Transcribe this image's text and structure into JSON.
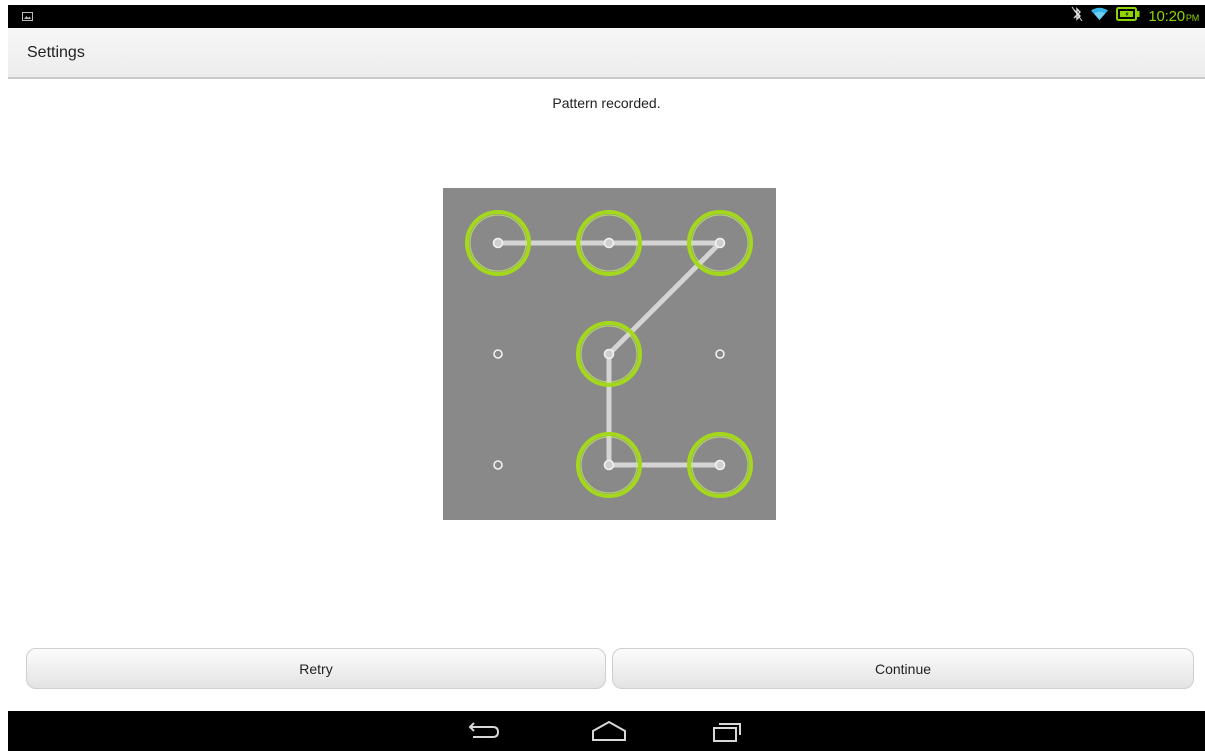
{
  "status_bar": {
    "time": "10:20",
    "ampm": "PM",
    "icons": [
      "picture-icon",
      "bluetooth-icon",
      "wifi-icon",
      "battery-icon"
    ]
  },
  "action_bar": {
    "title": "Settings"
  },
  "header": {
    "text": "Pattern recorded."
  },
  "pattern": {
    "grid": [
      [
        1,
        1,
        1
      ],
      [
        0,
        1,
        0
      ],
      [
        0,
        1,
        1
      ]
    ],
    "sequence": [
      [
        0,
        0
      ],
      [
        0,
        1
      ],
      [
        0,
        2
      ],
      [
        1,
        1
      ],
      [
        2,
        1
      ],
      [
        2,
        2
      ]
    ],
    "colors": {
      "ring": "#a4d81c",
      "line": "#d4d4d4",
      "background": "#898989"
    }
  },
  "buttons": {
    "retry_label": "Retry",
    "continue_label": "Continue"
  },
  "nav": {
    "icons": [
      "back-icon",
      "home-icon",
      "recent-apps-icon"
    ]
  }
}
